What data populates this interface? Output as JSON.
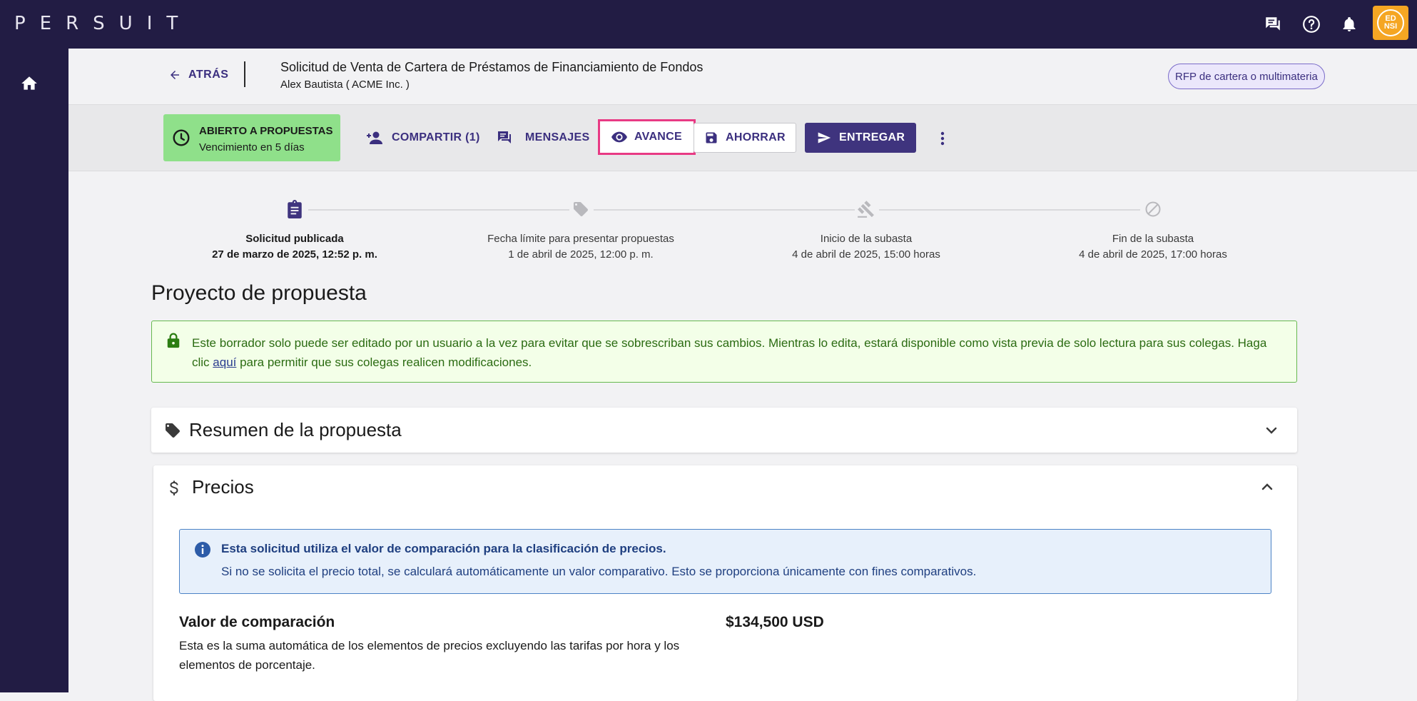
{
  "app": {
    "logo": "PERSUIT",
    "avatar_initials": "ED NSI"
  },
  "header": {
    "back_label": "ATRÁS",
    "request_title": "Solicitud de Venta de Cartera de Préstamos de Financiamiento de Fondos",
    "request_subtitle": "Alex Bautista ( ACME Inc. )",
    "rfp_badge": "RFP de cartera o multimateria"
  },
  "toolbar": {
    "status_title": "ABIERTO A PROPUESTAS",
    "status_sub": "Vencimiento en 5 días",
    "share_label": "COMPARTIR (1)",
    "messages_label": "MENSAJES",
    "preview_label": "AVANCE",
    "save_label": "AHORRAR",
    "submit_label": "ENTREGAR"
  },
  "timeline": [
    {
      "label": "Solicitud publicada",
      "date": "27 de marzo de 2025, 12:52 p. m."
    },
    {
      "label": "Fecha límite para presentar propuestas",
      "date": "1 de abril de 2025, 12:00 p. m."
    },
    {
      "label": "Inicio de la subasta",
      "date": "4 de abril de 2025, 15:00 horas"
    },
    {
      "label": "Fin de la subasta",
      "date": "4 de abril de 2025, 17:00 horas"
    }
  ],
  "main": {
    "page_title": "Proyecto de propuesta",
    "notice_text_1": "Este borrador solo puede ser editado por un usuario a la vez para evitar que se sobrescriban sus cambios. Mientras lo edita, estará disponible como vista previa de solo lectura para sus colegas. Haga clic ",
    "notice_link": "aquí",
    "notice_text_2": " para permitir que sus colegas realicen modificaciones.",
    "summary_title": "Resumen de la propuesta",
    "pricing_title": "Precios",
    "info_title": "Esta solicitud utiliza el valor de comparación para la clasificación de precios.",
    "info_text": "Si no se solicita el precio total, se calculará automáticamente un valor comparativo. Esto se proporciona únicamente con fines comparativos.",
    "comparison_label": "Valor de comparación",
    "comparison_desc": "Esta es la suma automática de los elementos de precios excluyendo las tarifas por hora y los elementos de porcentaje.",
    "comparison_value": "$134,500 USD"
  },
  "colors": {
    "nav_bg": "#221c44",
    "accent": "#3f347e",
    "status_green": "#8fe08a",
    "highlight_pink": "#e83a84",
    "avatar_orange": "#f5a623"
  }
}
